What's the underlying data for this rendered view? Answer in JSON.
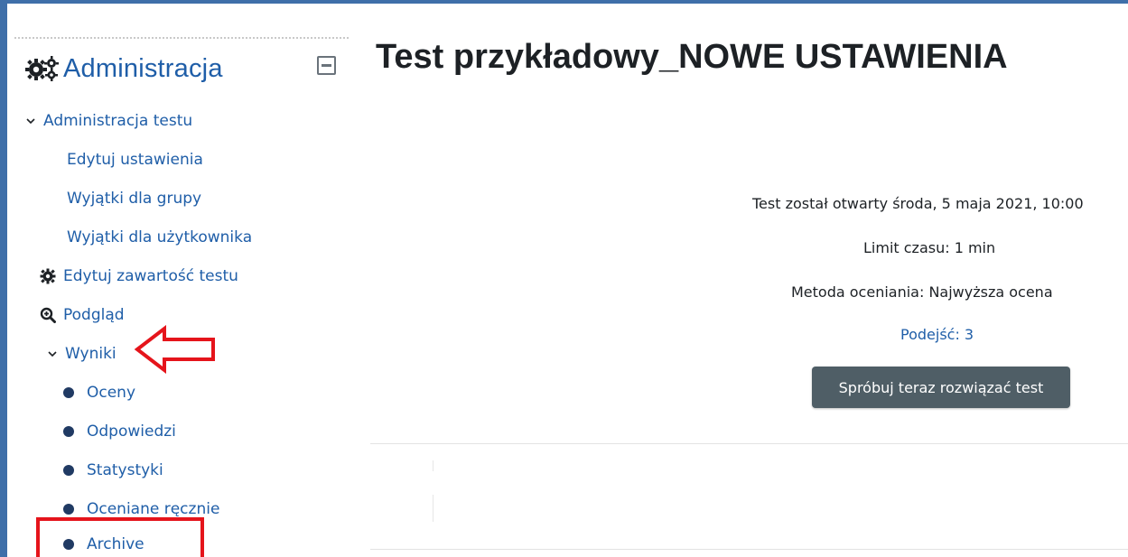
{
  "sidebar": {
    "header": "Administracja",
    "items": [
      {
        "label": "Administracja testu"
      },
      {
        "label": "Edytuj ustawienia"
      },
      {
        "label": "Wyjątki dla grupy"
      },
      {
        "label": "Wyjątki dla użytkownika"
      },
      {
        "label": "Edytuj zawartość testu"
      },
      {
        "label": "Podgląd"
      },
      {
        "label": "Wyniki"
      },
      {
        "label": "Oceny"
      },
      {
        "label": "Odpowiedzi"
      },
      {
        "label": "Statystyki"
      },
      {
        "label": "Oceniane ręcznie"
      },
      {
        "label": "Archive"
      }
    ]
  },
  "main": {
    "title": "Test przykładowy_NOWE USTAWIENIA",
    "opened": "Test został otwarty środa, 5 maja 2021, 10:00",
    "time_limit": "Limit czasu: 1 min",
    "grading_method": "Metoda oceniania: Najwyższa ocena",
    "attempts": "Podejść: 3",
    "attempt_button": "Spróbuj teraz rozwiązać test"
  },
  "colors": {
    "link": "#1f5ea8",
    "frame": "#3f6fa9",
    "button": "#4f5e66",
    "annotation": "#e5141b"
  },
  "icons": [
    "gears-icon",
    "collapse-block-icon",
    "chevron-down-icon",
    "gear-icon",
    "zoom-in-icon",
    "bullet-icon",
    "left-arrow-annotation"
  ]
}
